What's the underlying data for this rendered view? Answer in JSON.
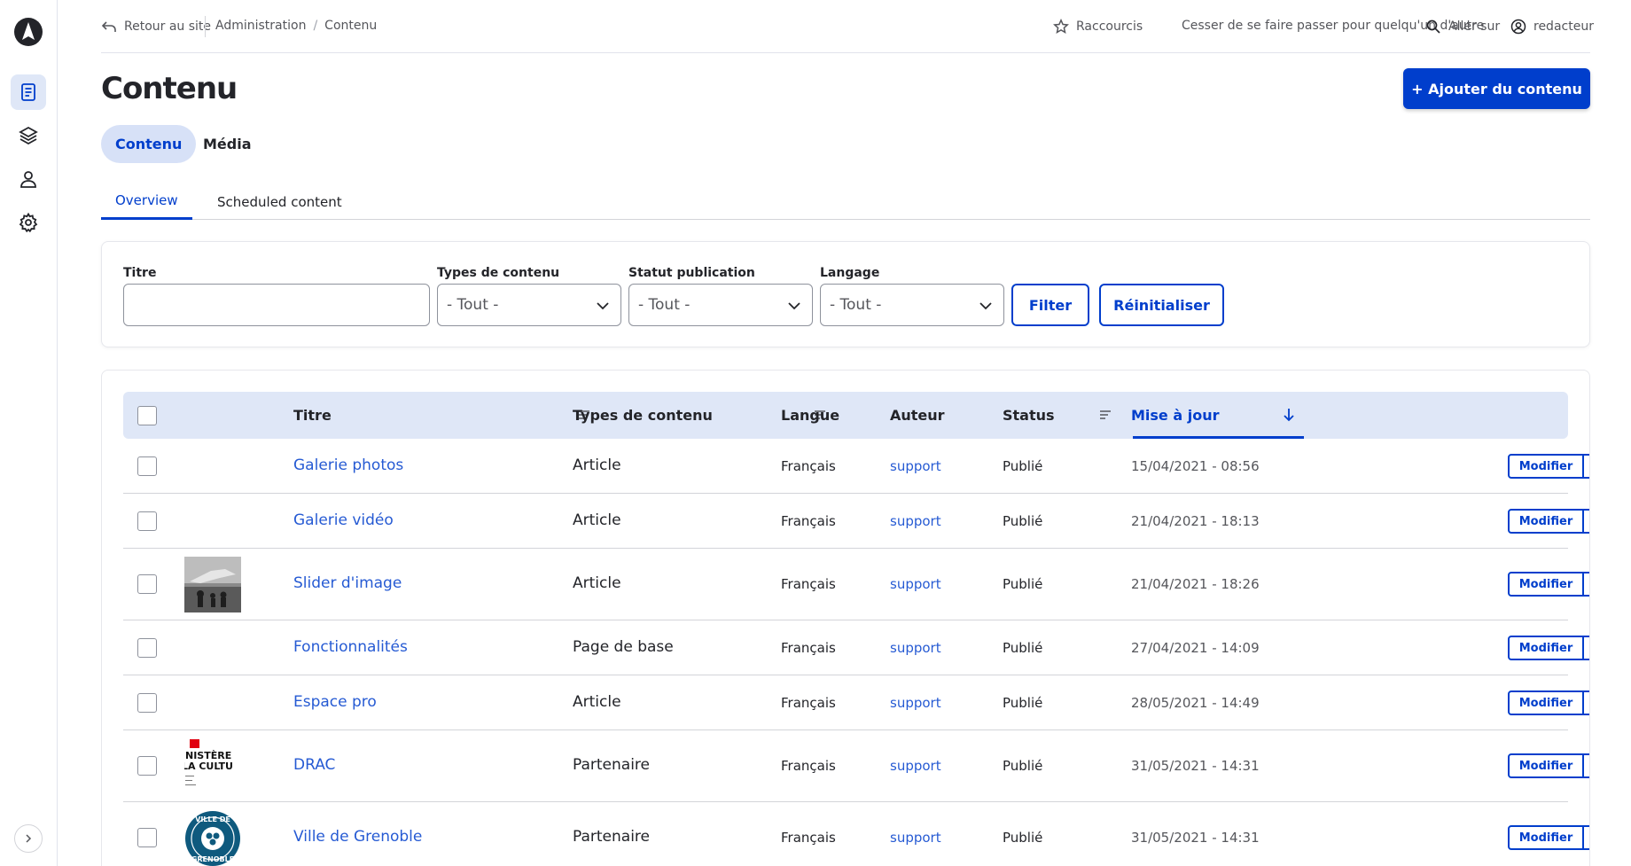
{
  "topbar": {
    "back": "Retour au site",
    "breadcrumb": [
      "Administration",
      "/",
      "Contenu"
    ],
    "shortcuts": "Raccourcis",
    "stop_masquerade": "Cesser de se faire passer pour quelqu'un d'autre",
    "goto": "Aller sur",
    "user": "redacteur"
  },
  "page": {
    "title": "Contenu",
    "add_button": "+ Ajouter du contenu"
  },
  "primary_tabs": [
    "Contenu",
    "Média"
  ],
  "secondary_tabs": [
    "Overview",
    "Scheduled content"
  ],
  "filters": {
    "title_label": "Titre",
    "title_value": "",
    "type_label": "Types de contenu",
    "type_value": "- Tout -",
    "status_label": "Statut publication",
    "status_value": "- Tout -",
    "lang_label": "Langage",
    "lang_value": "- Tout -",
    "filter_button": "Filter",
    "reset_button": "Réinitialiser"
  },
  "table": {
    "headers": {
      "title": "Titre",
      "type": "Types de contenu",
      "lang": "Langue",
      "author": "Auteur",
      "status": "Status",
      "updated": "Mise à jour"
    },
    "edit_label": "Modifier",
    "rows": [
      {
        "title": "Galerie photos",
        "type": "Article",
        "lang": "Français",
        "author": "support",
        "status": "Publié",
        "updated": "15/04/2021 - 08:56",
        "thumb": "none"
      },
      {
        "title": "Galerie vidéo",
        "type": "Article",
        "lang": "Français",
        "author": "support",
        "status": "Publié",
        "updated": "21/04/2021 - 18:13",
        "thumb": "none"
      },
      {
        "title": "Slider d'image",
        "type": "Article",
        "lang": "Français",
        "author": "support",
        "status": "Publié",
        "updated": "21/04/2021 - 18:26",
        "thumb": "photo"
      },
      {
        "title": "Fonctionnalités",
        "type": "Page de base",
        "lang": "Français",
        "author": "support",
        "status": "Publié",
        "updated": "27/04/2021 - 14:09",
        "thumb": "none"
      },
      {
        "title": "Espace pro",
        "type": "Article",
        "lang": "Français",
        "author": "support",
        "status": "Publié",
        "updated": "28/05/2021 - 14:49",
        "thumb": "none"
      },
      {
        "title": "DRAC",
        "type": "Partenaire",
        "lang": "Français",
        "author": "support",
        "status": "Publié",
        "updated": "31/05/2021 - 14:31",
        "thumb": "logo-ministere",
        "thumb_text": [
          "NISTÈRE",
          "LA CULTU"
        ]
      },
      {
        "title": "Ville de Grenoble",
        "type": "Partenaire",
        "lang": "Français",
        "author": "support",
        "status": "Publié",
        "updated": "31/05/2021 - 14:31",
        "thumb": "logo-grenoble",
        "thumb_text": [
          "VILLE DE",
          "GRENOBLE"
        ]
      }
    ]
  },
  "colors": {
    "accent": "#003ecc",
    "header_bg": "#dfe7f7",
    "active_tab_bg": "#d7e1f7"
  }
}
